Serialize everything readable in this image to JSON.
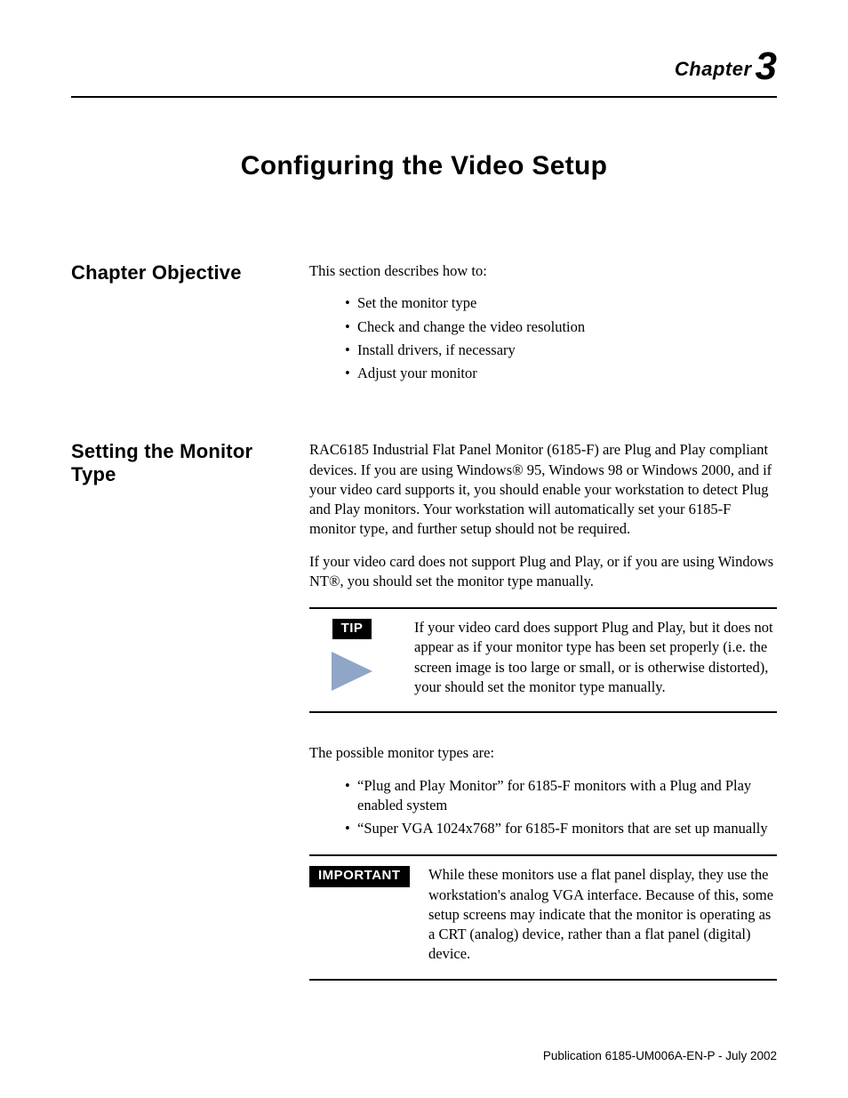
{
  "header": {
    "chapter_word": "Chapter",
    "chapter_num": "3"
  },
  "title": "Configuring the Video Setup",
  "section1": {
    "heading": "Chapter Objective",
    "intro": "This section describes how to:",
    "bullets": [
      "Set the monitor type",
      "Check and change the video resolution",
      "Install drivers, if necessary",
      "Adjust your monitor"
    ]
  },
  "section2": {
    "heading": "Setting the Monitor Type",
    "para1": "RAC6185 Industrial Flat Panel Monitor (6185-F) are Plug and Play compliant devices.  If you are using Windows® 95, Windows 98 or Windows 2000, and if your video card supports it, you should enable your workstation to detect Plug and Play monitors.  Your workstation will automatically set your 6185-F monitor type, and further setup should not be required.",
    "para2": "If your video card does not support Plug and Play, or if you are using Windows NT®, you should set the monitor type manually.",
    "tip_label": "TIP",
    "tip_text": "If your video card does support Plug and Play, but it does not appear as if your monitor type has been set properly (i.e. the screen image is too large or small, or is otherwise distorted), your should set the monitor type manually.",
    "para3": "The possible monitor types are:",
    "bullets": [
      "“Plug and Play Monitor” for 6185-F monitors with a Plug and Play enabled system",
      "“Super VGA 1024x768” for 6185-F monitors that are set up manually"
    ],
    "important_label": "IMPORTANT",
    "important_text": "While these monitors use a flat panel display, they use the workstation's analog VGA interface. Because of this, some setup screens may indicate that the monitor is operating as a CRT (analog) device, rather than a flat panel (digital) device."
  },
  "footer": "Publication 6185-UM006A-EN-P - July 2002"
}
